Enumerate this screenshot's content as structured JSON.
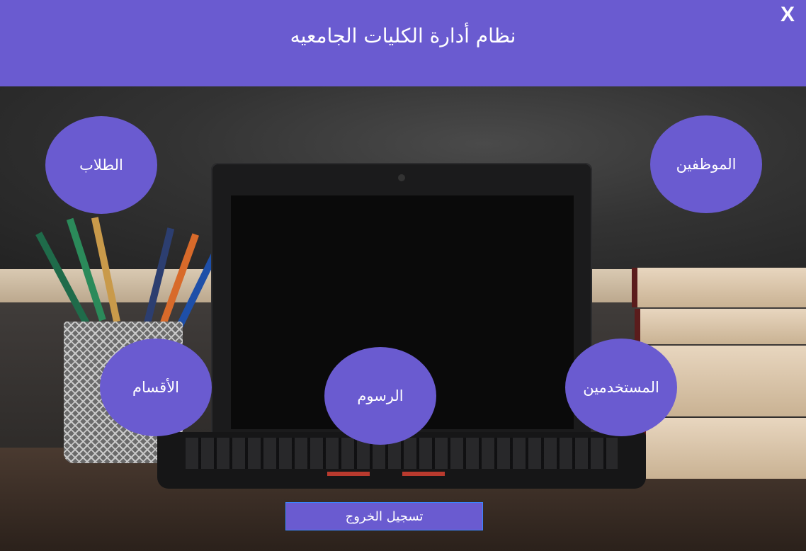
{
  "header": {
    "title": "نظام أدارة الكليات الجامعيه",
    "close_label": "X"
  },
  "nav": {
    "students": "الطلاب",
    "employees": "الموظفين",
    "departments": "الأقسام",
    "fees": "الرسوم",
    "users": "المستخدمين"
  },
  "footer": {
    "logout_label": "تسجيل الخروج"
  },
  "colors": {
    "accent": "#6a5bd0"
  }
}
